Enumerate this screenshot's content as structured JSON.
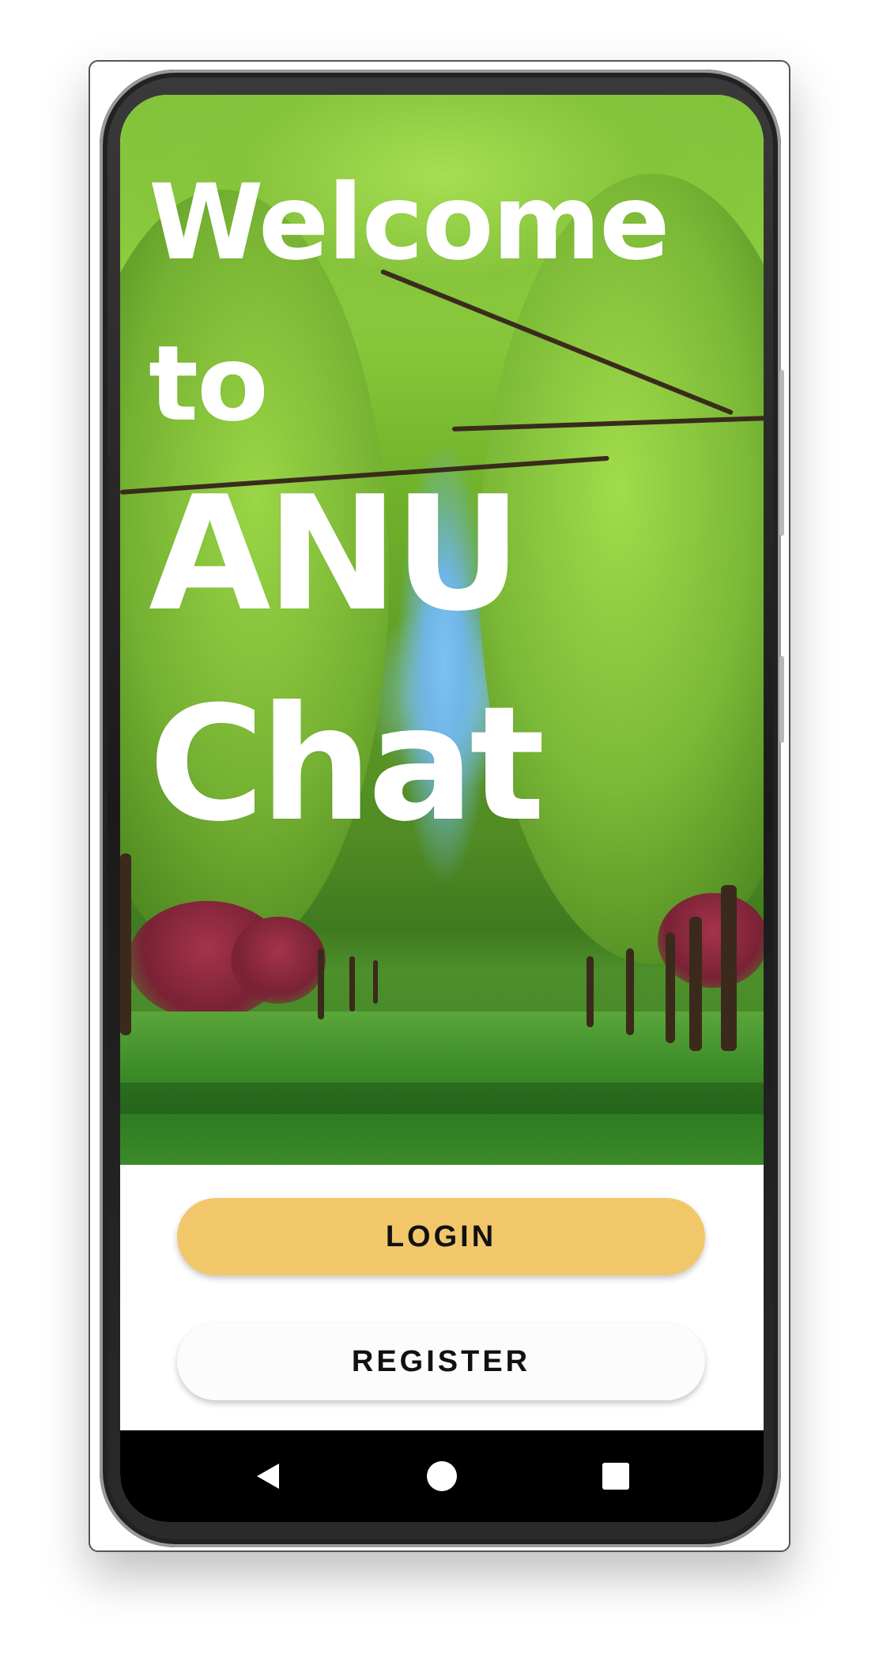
{
  "welcome": {
    "line1": "Welcome",
    "line2": "to",
    "line3": "ANU",
    "line4": "Chat"
  },
  "actions": {
    "login_label": "LOGIN",
    "register_label": "REGISTER"
  },
  "navigation": {
    "back_icon": "back-triangle",
    "home_icon": "home-circle",
    "recent_icon": "recents-square"
  },
  "colors": {
    "login_button": "#f2c76a",
    "register_button": "#fcfcfc",
    "nav_bar": "#000000",
    "title_text": "#ffffff"
  }
}
